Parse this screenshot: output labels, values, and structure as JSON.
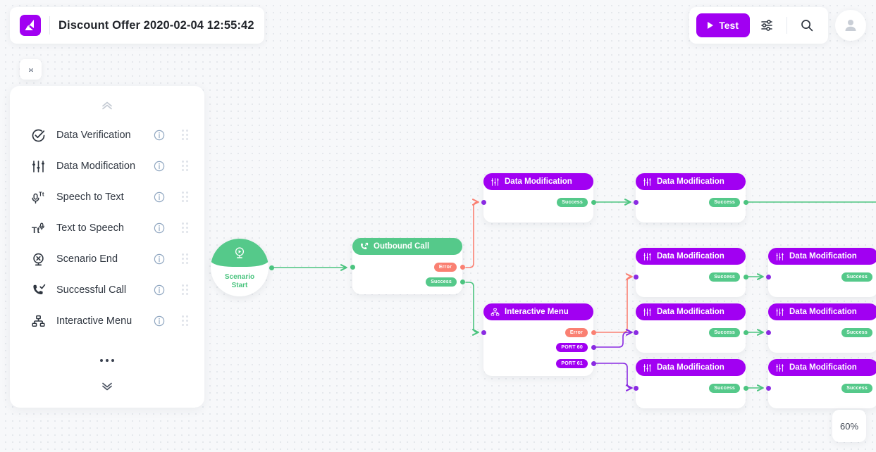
{
  "header": {
    "logo_icon": "app-logo-icon",
    "title": "Discount Offer 2020-02-04 12:55:42",
    "test_label": "Test",
    "play_icon": "play-icon",
    "settings_icon": "sliders-settings-icon",
    "search_icon": "search-icon",
    "avatar_icon": "user-avatar-icon"
  },
  "canvas_controls": {
    "collapse_label": "›‹",
    "zoom_level": "60%"
  },
  "sidebar": {
    "expand_up_icon": "chevron-double-up-icon",
    "expand_down_icon": "chevron-double-down-icon",
    "more_icon": "ellipsis-icon",
    "items": [
      {
        "label": "Data Verification",
        "icon": "check-circle-icon",
        "info_icon": "info-icon",
        "grip_icon": "drag-handle-icon"
      },
      {
        "label": "Data Modification",
        "icon": "sliders-icon",
        "info_icon": "info-icon",
        "grip_icon": "drag-handle-icon"
      },
      {
        "label": "Speech to Text",
        "icon": "microphone-text-icon",
        "info_icon": "info-icon",
        "grip_icon": "drag-handle-icon"
      },
      {
        "label": "Text to Speech",
        "icon": "text-microphone-icon",
        "info_icon": "info-icon",
        "grip_icon": "drag-handle-icon"
      },
      {
        "label": "Scenario End",
        "icon": "stop-circle-icon",
        "info_icon": "info-icon",
        "grip_icon": "drag-handle-icon"
      },
      {
        "label": "Successful Call",
        "icon": "phone-check-icon",
        "info_icon": "info-icon",
        "grip_icon": "drag-handle-icon"
      },
      {
        "label": "Interactive Menu",
        "icon": "sitemap-icon",
        "info_icon": "info-icon",
        "grip_icon": "drag-handle-icon"
      }
    ]
  },
  "flow": {
    "start_node": {
      "line1": "Scenario",
      "line2": "Start",
      "icon": "play-circle-icon"
    },
    "nodes": [
      {
        "id": "outbound",
        "title": "Outbound Call",
        "icon": "phone-outgoing-icon",
        "color": "green",
        "ports": [
          {
            "label": "Error",
            "type": "error"
          },
          {
            "label": "Success",
            "type": "success"
          }
        ]
      },
      {
        "id": "dm1",
        "title": "Data Modification",
        "icon": "sliders-icon",
        "color": "purple",
        "ports": [
          {
            "label": "Success",
            "type": "success"
          }
        ]
      },
      {
        "id": "dm2",
        "title": "Data Modification",
        "icon": "sliders-icon",
        "color": "purple",
        "ports": [
          {
            "label": "Success",
            "type": "success"
          }
        ]
      },
      {
        "id": "imenu",
        "title": "Interactive Menu",
        "icon": "sitemap-icon",
        "color": "purple",
        "ports": [
          {
            "label": "Error",
            "type": "error"
          },
          {
            "label": "PORT 60",
            "type": "port"
          },
          {
            "label": "PORT 61",
            "type": "port"
          }
        ]
      },
      {
        "id": "dm3",
        "title": "Data Modification",
        "icon": "sliders-icon",
        "color": "purple",
        "ports": [
          {
            "label": "Success",
            "type": "success"
          }
        ]
      },
      {
        "id": "dm4",
        "title": "Data Modification",
        "icon": "sliders-icon",
        "color": "purple",
        "ports": [
          {
            "label": "Success",
            "type": "success"
          }
        ]
      },
      {
        "id": "dm5",
        "title": "Data Modification",
        "icon": "sliders-icon",
        "color": "purple",
        "ports": [
          {
            "label": "Success",
            "type": "success"
          }
        ]
      },
      {
        "id": "dm6",
        "title": "Data Modification",
        "icon": "sliders-icon",
        "color": "purple",
        "ports": [
          {
            "label": "Success",
            "type": "success"
          }
        ]
      },
      {
        "id": "dm7",
        "title": "Data Modification",
        "icon": "sliders-icon",
        "color": "purple",
        "ports": [
          {
            "label": "Success",
            "type": "success"
          }
        ]
      },
      {
        "id": "dm8",
        "title": "Data Modification",
        "icon": "sliders-icon",
        "color": "purple",
        "ports": [
          {
            "label": "Success",
            "type": "success"
          }
        ]
      }
    ]
  },
  "colors": {
    "accent_purple": "#a100f2",
    "success_green": "#55c98a",
    "error_salmon": "#fa8072",
    "edge_purple": "#8a2be2",
    "canvas_bg": "#f7f8fa"
  }
}
